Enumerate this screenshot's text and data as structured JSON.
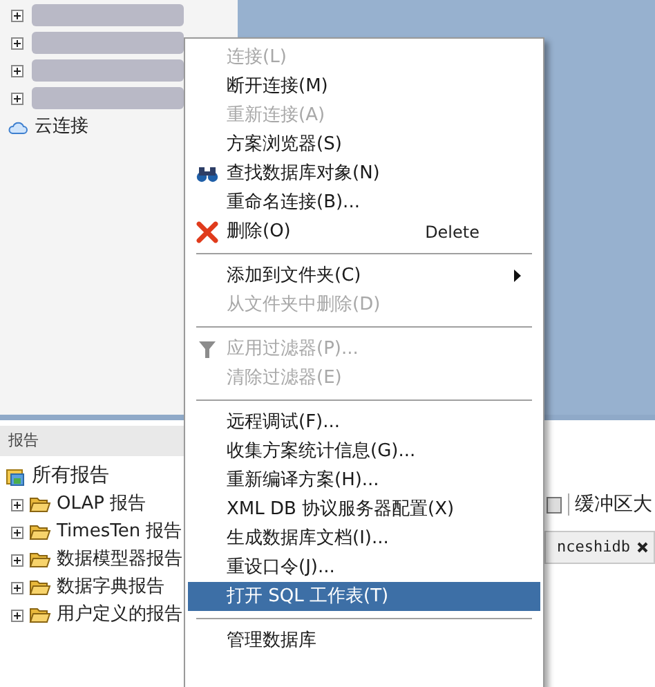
{
  "connections": [
    {
      "expanded": false
    },
    {
      "expanded": false
    },
    {
      "expanded": false
    },
    {
      "expanded": false
    }
  ],
  "cloud_connection": {
    "label": "云连接"
  },
  "reports_panel": {
    "title": "报告",
    "root": "所有报告",
    "children": [
      {
        "label": "OLAP 报告",
        "expanded": false
      },
      {
        "label": "TimesTen 报告",
        "expanded": false
      },
      {
        "label": "数据模型器报告",
        "expanded": false
      },
      {
        "label": "数据字典报告",
        "expanded": false
      },
      {
        "label": "用户定义的报告",
        "expanded": false
      }
    ]
  },
  "editor": {
    "toolbar_label": "缓冲区大",
    "tab": {
      "label": "nceshidb"
    }
  },
  "context_menu": [
    {
      "kind": "item",
      "label": "连接(L)",
      "disabled": true,
      "selected": false
    },
    {
      "kind": "item",
      "label": "断开连接(M)",
      "disabled": false,
      "selected": false
    },
    {
      "kind": "item",
      "label": "重新连接(A)",
      "disabled": true,
      "selected": false
    },
    {
      "kind": "item",
      "label": "方案浏览器(S)",
      "disabled": false,
      "selected": false
    },
    {
      "kind": "item",
      "label": "查找数据库对象(N)",
      "disabled": false,
      "selected": false
    },
    {
      "kind": "item",
      "label": "重命名连接(B)...",
      "disabled": false,
      "selected": false
    },
    {
      "kind": "item",
      "label": "删除(O)",
      "disabled": false,
      "selected": false,
      "shortcut": "Delete"
    },
    {
      "kind": "separator"
    },
    {
      "kind": "item",
      "label": "添加到文件夹(C)",
      "disabled": false,
      "selected": false,
      "submenu": true
    },
    {
      "kind": "item",
      "label": "从文件夹中删除(D)",
      "disabled": true,
      "selected": false
    },
    {
      "kind": "separator"
    },
    {
      "kind": "item",
      "label": "应用过滤器(P)...",
      "disabled": true,
      "selected": false
    },
    {
      "kind": "item",
      "label": "清除过滤器(E)",
      "disabled": true,
      "selected": false
    },
    {
      "kind": "separator"
    },
    {
      "kind": "item",
      "label": "远程调试(F)...",
      "disabled": false,
      "selected": false
    },
    {
      "kind": "item",
      "label": "收集方案统计信息(G)...",
      "disabled": false,
      "selected": false
    },
    {
      "kind": "item",
      "label": "重新编译方案(H)...",
      "disabled": false,
      "selected": false
    },
    {
      "kind": "item",
      "label": "XML DB 协议服务器配置(X)",
      "disabled": false,
      "selected": false
    },
    {
      "kind": "item",
      "label": "生成数据库文档(I)...",
      "disabled": false,
      "selected": false
    },
    {
      "kind": "item",
      "label": "重设口令(J)...",
      "disabled": false,
      "selected": false
    },
    {
      "kind": "item",
      "label": "打开 SQL 工作表(T)",
      "disabled": false,
      "selected": true
    },
    {
      "kind": "separator"
    },
    {
      "kind": "item",
      "label": "管理数据库",
      "disabled": false,
      "selected": false
    }
  ]
}
